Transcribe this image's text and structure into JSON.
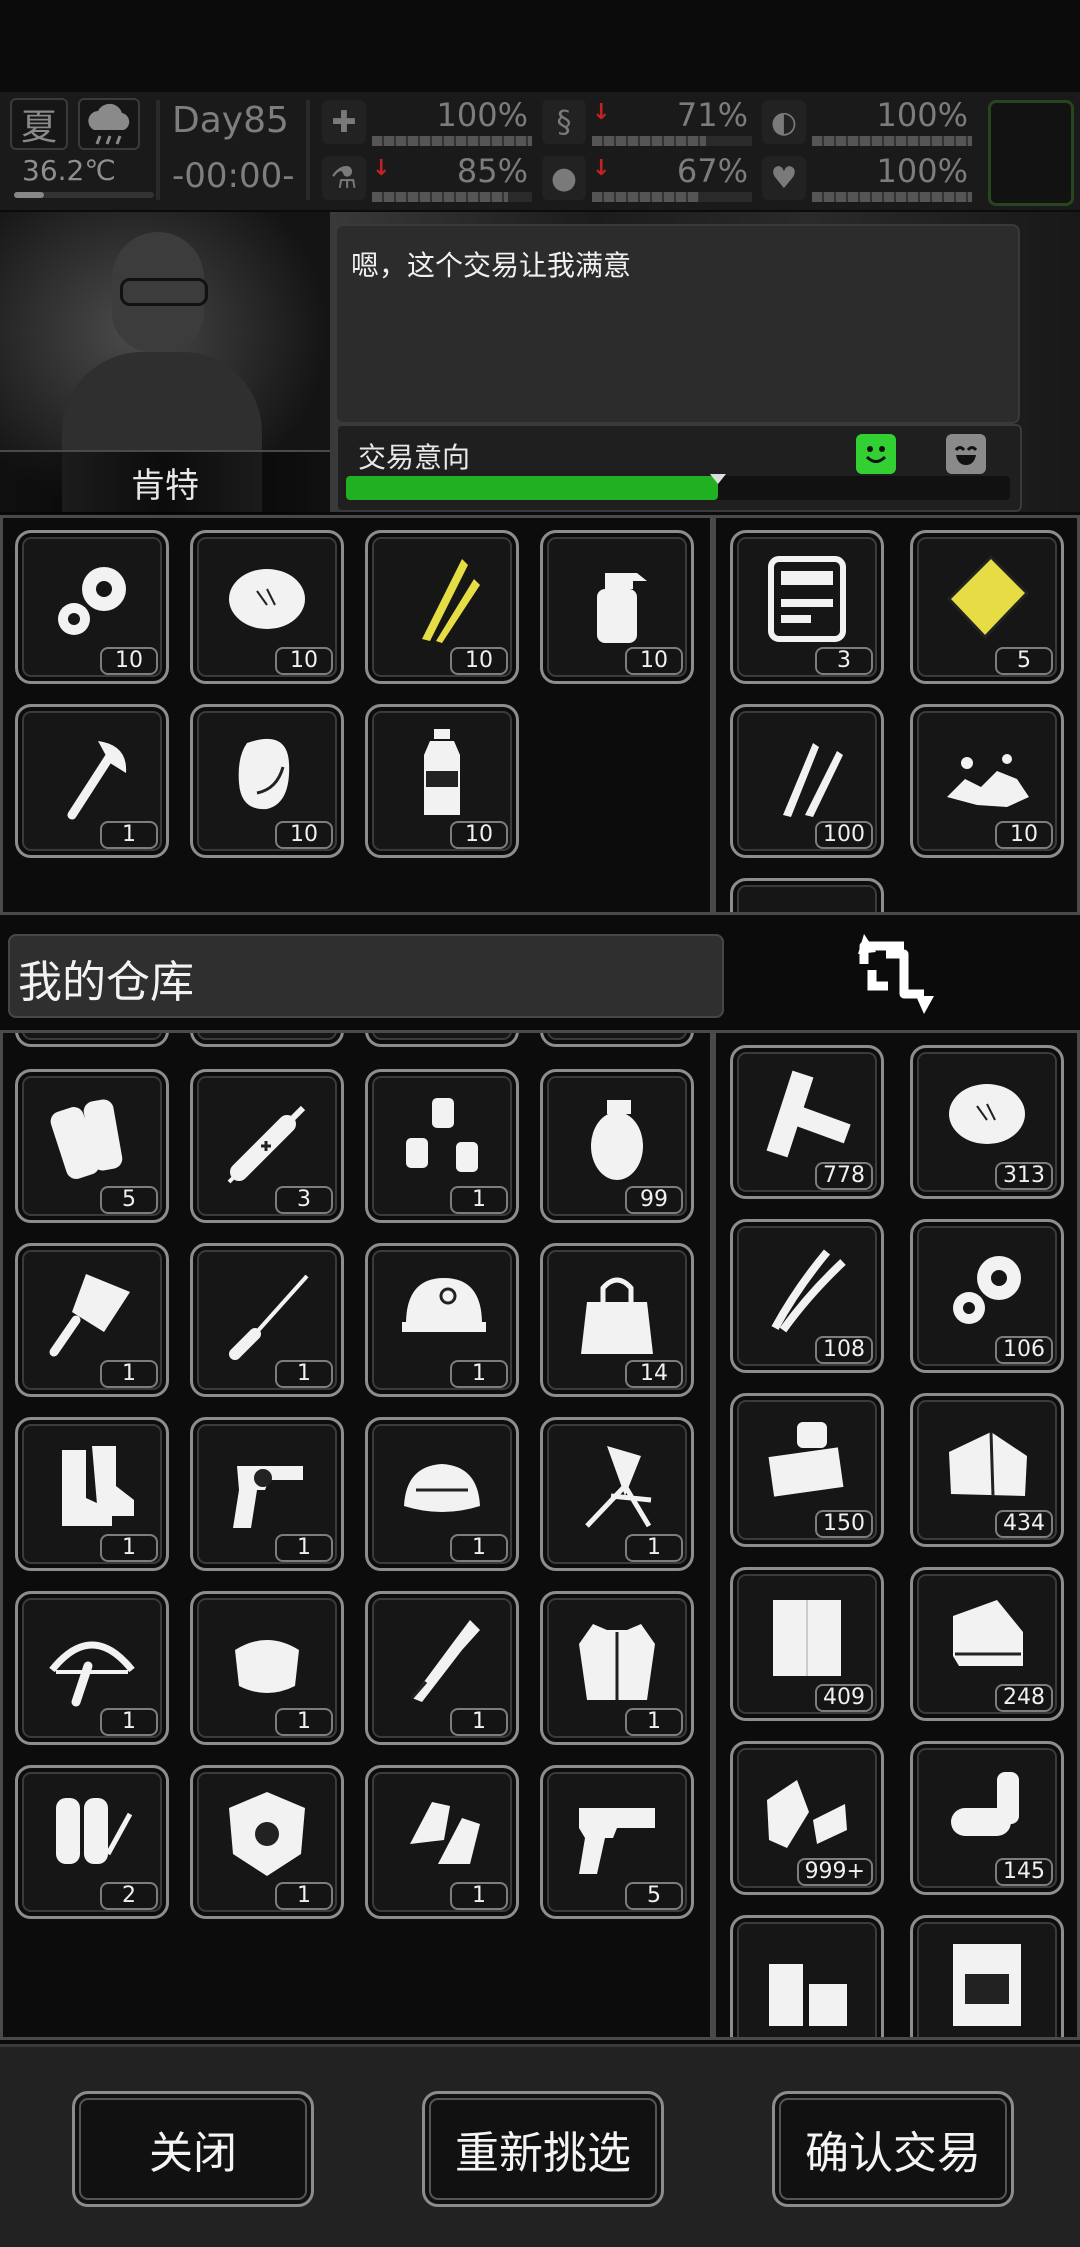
{
  "status": {
    "season": "夏",
    "temperature": "36.2℃",
    "day": "Day85",
    "time": "-00:00-",
    "stats": [
      {
        "icon": "medkit-icon",
        "value": "100%",
        "level": 100,
        "dropping": false
      },
      {
        "icon": "stomach-icon",
        "value": "71%",
        "level": 71,
        "dropping": true
      },
      {
        "icon": "pill-icon",
        "value": "100%",
        "level": 100,
        "dropping": false
      },
      {
        "icon": "flask-icon",
        "value": "85%",
        "level": 85,
        "dropping": true
      },
      {
        "icon": "water-drop-icon",
        "value": "67%",
        "level": 67,
        "dropping": true
      },
      {
        "icon": "heart-icon",
        "value": "100%",
        "level": 100,
        "dropping": false
      }
    ]
  },
  "npc": {
    "name": "肯特",
    "dialog": "嗯，这个交易让我满意",
    "intent_label": "交易意向",
    "intent_level": 0.56
  },
  "npc_offer": [
    {
      "icon": "gears-icon",
      "count": "10"
    },
    {
      "icon": "fur-icon",
      "count": "10"
    },
    {
      "icon": "feathers-icon",
      "count": "10"
    },
    {
      "icon": "spray-bottle-icon",
      "count": "10"
    },
    {
      "icon": "axe-icon",
      "count": "1"
    },
    {
      "icon": "raw-meat-icon",
      "count": "10"
    },
    {
      "icon": "water-bottle-icon",
      "count": "10"
    }
  ],
  "npc_stock": [
    {
      "icon": "toolkit-icon",
      "count": "3"
    },
    {
      "icon": "gold-plate-icon",
      "count": "5"
    },
    {
      "icon": "bullets-icon",
      "count": "100"
    },
    {
      "icon": "rubble-icon",
      "count": "10"
    }
  ],
  "warehouse": {
    "title": "我的仓库",
    "swap_icon": "swap-icon"
  },
  "my_offer": [
    {
      "icon": "paper-rolls-icon",
      "count": "5"
    },
    {
      "icon": "syringe-icon",
      "count": "3"
    },
    {
      "icon": "pill-bottles-icon",
      "count": "1"
    },
    {
      "icon": "grenade-icon",
      "count": "99"
    },
    {
      "icon": "cleaver-icon",
      "count": "1"
    },
    {
      "icon": "screwdriver-icon",
      "count": "1"
    },
    {
      "icon": "helmet-icon",
      "count": "1"
    },
    {
      "icon": "bag-icon",
      "count": "14"
    },
    {
      "icon": "boots-icon",
      "count": "1"
    },
    {
      "icon": "revolver-icon",
      "count": "1"
    },
    {
      "icon": "fur-hat-icon",
      "count": "1"
    },
    {
      "icon": "folding-chair-icon",
      "count": "1"
    },
    {
      "icon": "crossbow-icon",
      "count": "1"
    },
    {
      "icon": "fur-scarf-icon",
      "count": "1"
    },
    {
      "icon": "machete-icon",
      "count": "1"
    },
    {
      "icon": "fur-vest-icon",
      "count": "1"
    },
    {
      "icon": "flamethrower-tank-icon",
      "count": "2"
    },
    {
      "icon": "shield-icon",
      "count": "1"
    },
    {
      "icon": "gloves-icon",
      "count": "1"
    },
    {
      "icon": "pistol-icon",
      "count": "5"
    }
  ],
  "my_stock": [
    {
      "icon": "planks-icon",
      "count": "778"
    },
    {
      "icon": "fur-icon",
      "count": "313"
    },
    {
      "icon": "wires-icon",
      "count": "108"
    },
    {
      "icon": "gears-icon",
      "count": "106"
    },
    {
      "icon": "circuit-parts-icon",
      "count": "150"
    },
    {
      "icon": "cloth-icon",
      "count": "434"
    },
    {
      "icon": "paper-icon",
      "count": "409"
    },
    {
      "icon": "towel-icon",
      "count": "248"
    },
    {
      "icon": "scrap-metal-icon",
      "count": "999+"
    },
    {
      "icon": "pipes-icon",
      "count": "145"
    },
    {
      "icon": "wood-blocks-icon",
      "count": ""
    },
    {
      "icon": "battery-box-icon",
      "count": ""
    }
  ],
  "buttons": {
    "close": "关闭",
    "reselect": "重新挑选",
    "confirm": "确认交易"
  },
  "colors": {
    "intent_fill": "#21b021",
    "happy_face": "#32d032",
    "feather_accent": "#e6dd45"
  }
}
